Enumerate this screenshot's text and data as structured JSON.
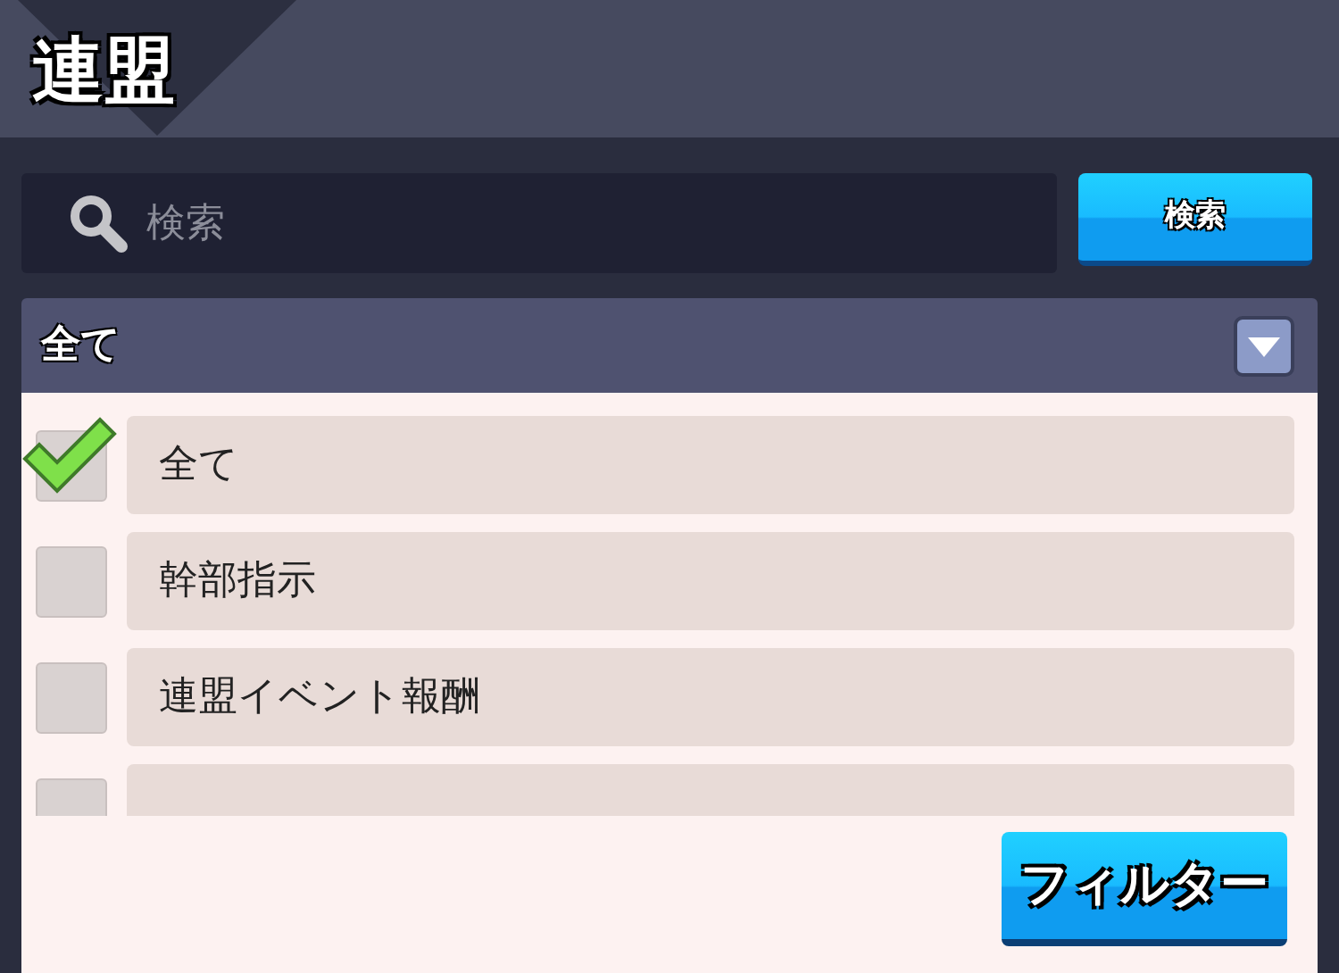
{
  "title": "連盟",
  "search": {
    "placeholder": "検索",
    "button": "検索"
  },
  "dropdown": {
    "value": "全て"
  },
  "options": [
    {
      "label": "全て",
      "checked": true
    },
    {
      "label": "幹部指示",
      "checked": false
    },
    {
      "label": "連盟イベント報酬",
      "checked": false
    },
    {
      "checked": false
    }
  ],
  "filter_button": "フィルター"
}
